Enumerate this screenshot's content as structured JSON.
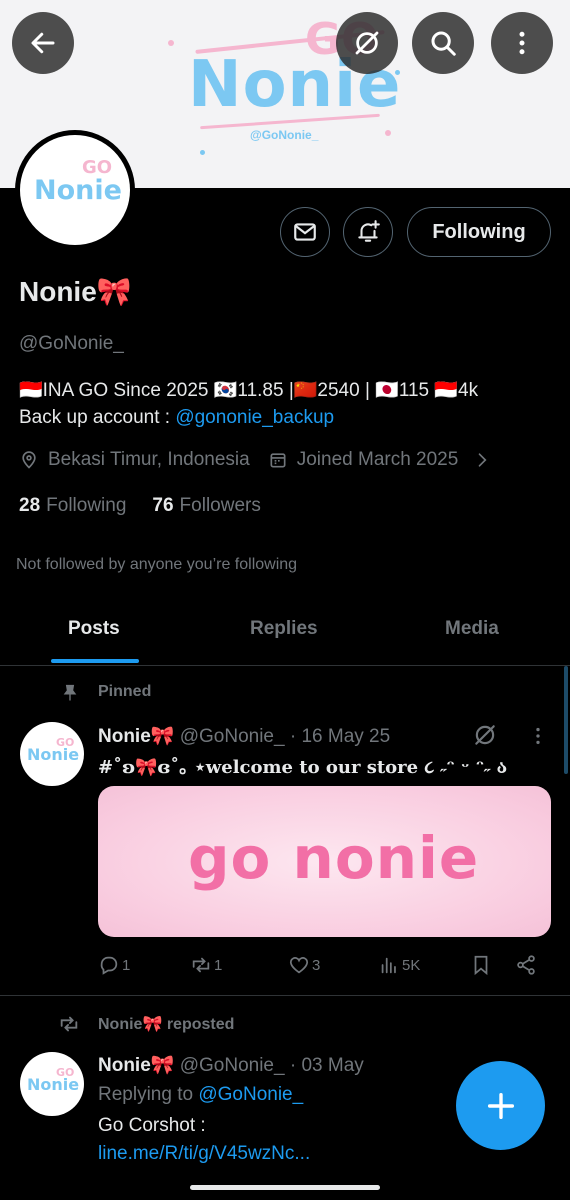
{
  "banner": {
    "brand_name": "Nonie",
    "brand_go": "GO",
    "brand_handle": "@GoNonie_",
    "colors": {
      "blue": "#7cc8f2",
      "pink": "#f5b6cf",
      "bg": "#f3f3f5"
    }
  },
  "top_bar": {
    "back_icon": "arrow-left-icon",
    "grok_icon": "grok-icon",
    "search_icon": "search-icon",
    "more_icon": "more-vertical-icon"
  },
  "profile": {
    "avatar_text_main": "Nonie",
    "avatar_text_go": "GO",
    "display_name": "Nonie🎀",
    "handle": "@GoNonie_",
    "bio_line1": "🇮🇩INA GO Since 2025 🇰🇷11.85 |🇨🇳2540 | 🇯🇵115 🇮🇩4k",
    "bio_line2_prefix": "Back up account : ",
    "bio_line2_link": "@gononie_backup",
    "location": "Bekasi Timur, Indonesia",
    "joined": "Joined March 2025",
    "following_count": "28",
    "following_label": "Following",
    "followers_count": "76",
    "followers_label": "Followers",
    "not_followed_text": "Not followed by anyone you’re following",
    "following_button": "Following"
  },
  "tabs": [
    {
      "label": "Posts",
      "active": true
    },
    {
      "label": "Replies",
      "active": false
    },
    {
      "label": "Media",
      "active": false
    }
  ],
  "posts": [
    {
      "pinned_label": "Pinned",
      "name": "Nonie🎀",
      "handle": "@GoNonie_",
      "date": "· 16 May 25",
      "text": "#˚ʚ🎀ɞ˚｡ ⋆welcome to our store ૮ ˶ᵔ ᵕ ᵔ˶ ა",
      "media_text": "go nonie",
      "replies": "1",
      "reposts": "1",
      "likes": "3",
      "views": "5K"
    },
    {
      "repost_label": "Nonie🎀 reposted",
      "name": "Nonie🎀",
      "handle": "@GoNonie_",
      "date": "· 03 May",
      "replying_prefix": "Replying to ",
      "replying_to": "@GoNonie_",
      "text": "Go Corshot :",
      "link": "line.me/R/ti/g/V45wzNc..."
    }
  ],
  "accent": "#1d9bf0"
}
